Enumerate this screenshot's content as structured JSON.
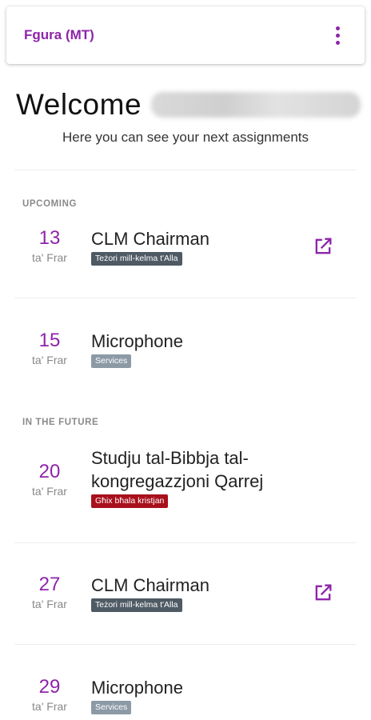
{
  "appbar": {
    "title": "Fgura (MT)"
  },
  "welcome": {
    "greeting": "Welcome",
    "subtitle": "Here you can see your next assignments"
  },
  "sections": {
    "upcoming": "UPCOMING",
    "future": "IN THE FUTURE"
  },
  "colors": {
    "accent": "#8e24aa",
    "badge_gray": "#4e5a64",
    "badge_light": "#8c9aa6",
    "badge_red": "#a8101c"
  },
  "assignments": [
    {
      "day": "13",
      "month": "ta' Frar",
      "title": "CLM Chairman",
      "badge": "Teżori mill-kelma t'Alla",
      "has_link": true
    },
    {
      "day": "15",
      "month": "ta' Frar",
      "title": "Microphone",
      "badge": "Services",
      "has_link": false
    },
    {
      "day": "20",
      "month": "ta' Frar",
      "title_line1": "Studju tal-Bibbja tal-",
      "title_line2": "kongregazzjoni Qarrej",
      "badge": "Għix bħala kristjan",
      "has_link": false
    },
    {
      "day": "27",
      "month": "ta' Frar",
      "title": "CLM Chairman",
      "badge": "Teżori mill-kelma t'Alla",
      "has_link": true
    },
    {
      "day": "29",
      "month": "ta' Frar",
      "title": "Microphone",
      "badge": "Services",
      "has_link": false
    }
  ]
}
